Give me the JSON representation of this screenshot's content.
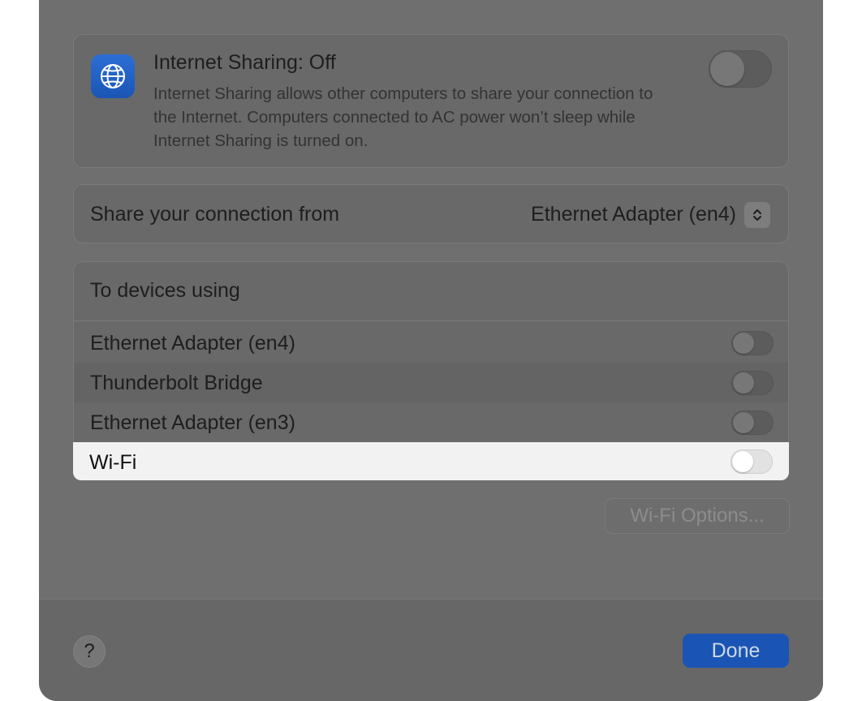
{
  "sharing": {
    "icon": "globe-icon",
    "title": "Internet Sharing: Off",
    "description": "Internet Sharing allows other computers to share your connection to the Internet. Computers connected to AC power won’t sleep while Internet Sharing is turned on.",
    "enabled": false
  },
  "share_from": {
    "label": "Share your connection from",
    "selected": "Ethernet Adapter (en4)"
  },
  "devices": {
    "header": "To devices using",
    "items": [
      {
        "label": "Ethernet Adapter (en4)",
        "enabled": false
      },
      {
        "label": "Thunderbolt Bridge",
        "enabled": false
      },
      {
        "label": "Ethernet Adapter (en3)",
        "enabled": false
      },
      {
        "label": "Wi-Fi",
        "enabled": false
      }
    ]
  },
  "wifi_options_label": "Wi-Fi Options...",
  "footer": {
    "help_label": "?",
    "done_label": "Done"
  },
  "colors": {
    "accent": "#1a55b5",
    "overlay": "#6f6f6f",
    "highlight": "#f2f2f2"
  }
}
